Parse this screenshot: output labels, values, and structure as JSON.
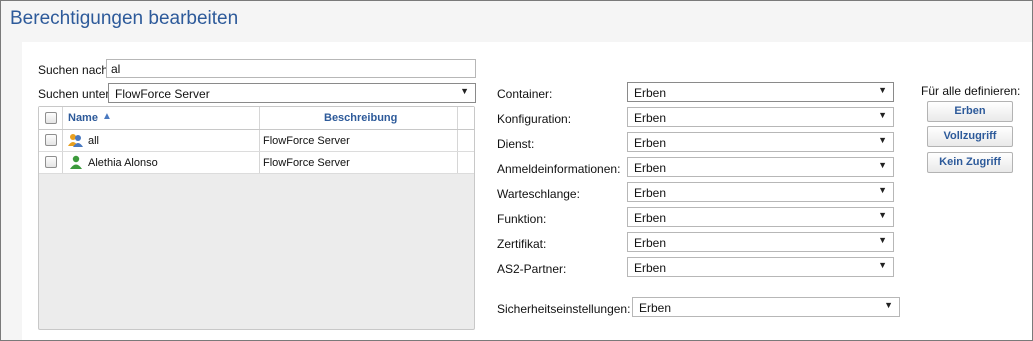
{
  "page_title": "Berechtigungen bearbeiten",
  "search": {
    "label": "Suchen nach:",
    "value": "al",
    "scope_label": "Suchen unter:",
    "scope_value": "FlowForce Server"
  },
  "table": {
    "columns": [
      "Name",
      "Beschreibung"
    ],
    "rows": [
      {
        "name": "all",
        "description": "FlowForce Server",
        "icon": "group-icon"
      },
      {
        "name": "Alethia Alonso",
        "description": "FlowForce Server",
        "icon": "user-icon"
      }
    ]
  },
  "permissions": [
    {
      "label": "Container:",
      "value": "Erben"
    },
    {
      "label": "Konfiguration:",
      "value": "Erben"
    },
    {
      "label": "Dienst:",
      "value": "Erben"
    },
    {
      "label": "Anmeldeinformationen:",
      "value": "Erben"
    },
    {
      "label": "Warteschlange:",
      "value": "Erben"
    },
    {
      "label": "Funktion:",
      "value": "Erben"
    },
    {
      "label": "Zertifikat:",
      "value": "Erben"
    },
    {
      "label": "AS2-Partner:",
      "value": "Erben"
    }
  ],
  "security": {
    "label": "Sicherheitseinstellungen:",
    "value": "Erben"
  },
  "define_all": {
    "label": "Für alle definieren:",
    "buttons": [
      "Erben",
      "Vollzugriff",
      "Kein Zugriff"
    ]
  },
  "colors": {
    "accent": "#2d5a9a",
    "user_icon": "#3c9a3c",
    "group_icon": "#e8a020"
  }
}
